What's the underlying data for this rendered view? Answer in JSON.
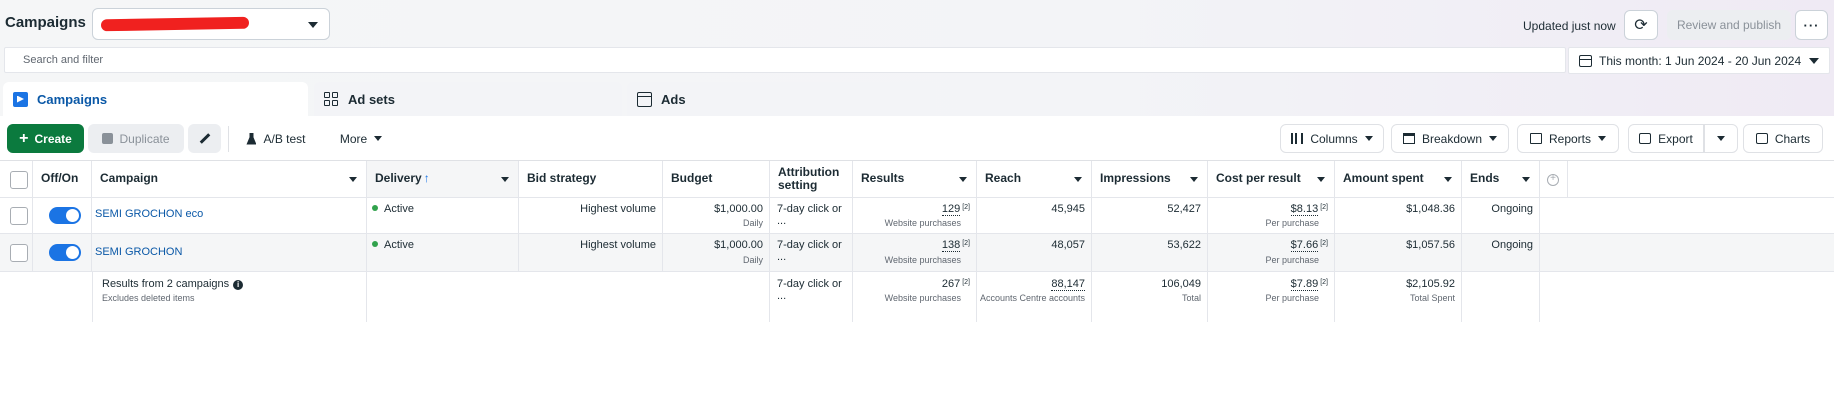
{
  "header": {
    "title": "Campaigns",
    "updated": "Updated just now",
    "review_publish": "Review and publish",
    "more": "···"
  },
  "search": {
    "placeholder": "Search and filter"
  },
  "date_range": {
    "label": "This month: 1 Jun 2024 - 20 Jun 2024"
  },
  "tabs": [
    {
      "label": "Campaigns",
      "icon": "campaigns-icon"
    },
    {
      "label": "Ad sets",
      "icon": "ad-sets-icon"
    },
    {
      "label": "Ads",
      "icon": "ads-icon"
    }
  ],
  "toolbar": {
    "create": "Create",
    "duplicate": "Duplicate",
    "ab_test": "A/B test",
    "more": "More",
    "columns": "Columns",
    "breakdown": "Breakdown",
    "reports": "Reports",
    "export": "Export",
    "charts": "Charts"
  },
  "table": {
    "columns": {
      "off_on": "Off/On",
      "campaign": "Campaign",
      "delivery": "Delivery",
      "bid_strategy": "Bid strategy",
      "budget": "Budget",
      "attribution_line1": "Attribution",
      "attribution_line2": "setting",
      "results": "Results",
      "reach": "Reach",
      "impressions": "Impressions",
      "cost_per_result": "Cost per result",
      "amount_spent": "Amount spent",
      "ends": "Ends"
    },
    "rows": [
      {
        "campaign": "SEMI GROCHON eco",
        "on": true,
        "delivery": "Active",
        "bid_strategy": "Highest volume",
        "budget": "$1,000.00",
        "budget_sub": "Daily",
        "attribution": "7-day click or ...",
        "results": "129",
        "results_sub": "Website purchases",
        "reach": "45,945",
        "impressions": "52,427",
        "cost_per_result": "$8.13",
        "cost_sub": "Per purchase",
        "amount_spent": "$1,048.36",
        "ends": "Ongoing"
      },
      {
        "campaign": "SEMI GROCHON",
        "on": true,
        "delivery": "Active",
        "bid_strategy": "Highest volume",
        "budget": "$1,000.00",
        "budget_sub": "Daily",
        "attribution": "7-day click or ...",
        "results": "138",
        "results_sub": "Website purchases",
        "reach": "48,057",
        "impressions": "53,622",
        "cost_per_result": "$7.66",
        "cost_sub": "Per purchase",
        "amount_spent": "$1,057.56",
        "ends": "Ongoing"
      }
    ],
    "sup_marker": "[2]",
    "totals": {
      "label": "Results from 2 campaigns",
      "sublabel": "Excludes deleted items",
      "attribution": "7-day click or ...",
      "results": "267",
      "results_sub": "Website purchases",
      "reach": "88,147",
      "reach_sub": "Accounts Centre accounts",
      "impressions": "106,049",
      "impressions_sub": "Total",
      "cost_per_result": "$7.89",
      "cost_sub": "Per purchase",
      "amount_spent": "$2,105.92",
      "amount_sub": "Total Spent"
    }
  },
  "colors": {
    "primary_blue": "#1b74e4",
    "link_blue": "#0a58a7",
    "create_green": "#0b7a3e",
    "active_green": "#31a24c",
    "redaction_red": "#f0211f"
  }
}
